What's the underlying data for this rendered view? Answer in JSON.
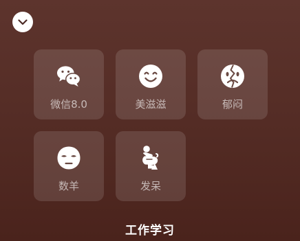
{
  "collapse": {
    "icon": "chevron-down-icon"
  },
  "tiles": [
    {
      "label": "微信8.0",
      "icon": "wechat-icon"
    },
    {
      "label": "美滋滋",
      "icon": "smile-icon"
    },
    {
      "label": "郁闷",
      "icon": "sad-face-icon"
    },
    {
      "label": "数羊",
      "icon": "sheep-mask-icon"
    },
    {
      "label": "发呆",
      "icon": "daze-figure-icon"
    }
  ],
  "footer": {
    "title": "工作学习"
  },
  "colors": {
    "background_top": "#5d342d",
    "background_bottom": "#4a231c",
    "tile_background": "rgba(255,255,255,0.12)",
    "icon": "#ffffff",
    "label": "rgba(255,255,255,0.62)"
  }
}
